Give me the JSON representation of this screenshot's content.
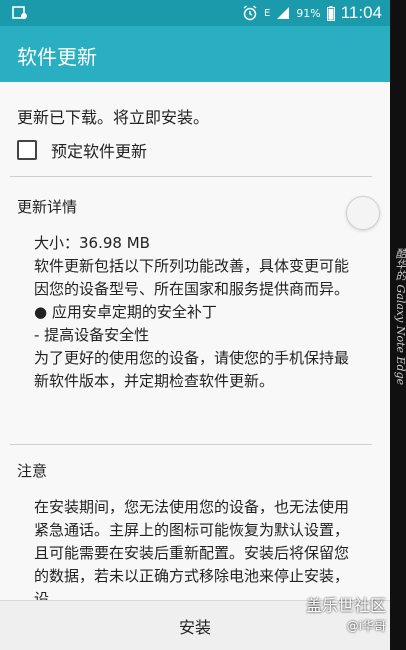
{
  "statusbar": {
    "battery_percent": "91%",
    "time": "11:04",
    "network_label": "E",
    "icons": [
      "notification-image-icon",
      "alarm-icon",
      "signal-icon",
      "battery-icon"
    ]
  },
  "appbar": {
    "title": "软件更新"
  },
  "status": {
    "message": "更新已下载。将立即安装。"
  },
  "schedule": {
    "label": "预定软件更新",
    "checked": false
  },
  "details": {
    "title": "更新详情",
    "size": "大小：36.98 MB",
    "intro": "软件更新包括以下所列功能改善，具体变更可能因您的设备型号、所在国家和服务提供商而异。",
    "bullet": "● 应用安卓定期的安全补丁",
    "dash": "- 提高设备安全性",
    "closing": "为了更好的使用您的设备，请使您的手机保持最新软件版本，并定期检查软件更新。"
  },
  "notice": {
    "title": "注意",
    "body": "在安装期间，您无法使用您的设备，也无法使用紧急通话。主屏上的图标可能恢复为默认设置，且可能需要在安装后重新配置。安装后将保留您的数据，若未以正确方式移除电池来停止安装，设"
  },
  "actions": {
    "install_label": "安装"
  },
  "watermark": {
    "line1": "盖乐世社区",
    "line2": "@i华哥"
  },
  "edge_caption": "酷华的 Galaxy Note Edge",
  "colors": {
    "statusbar": "#1a9aab",
    "appbar": "#2aaec2"
  }
}
